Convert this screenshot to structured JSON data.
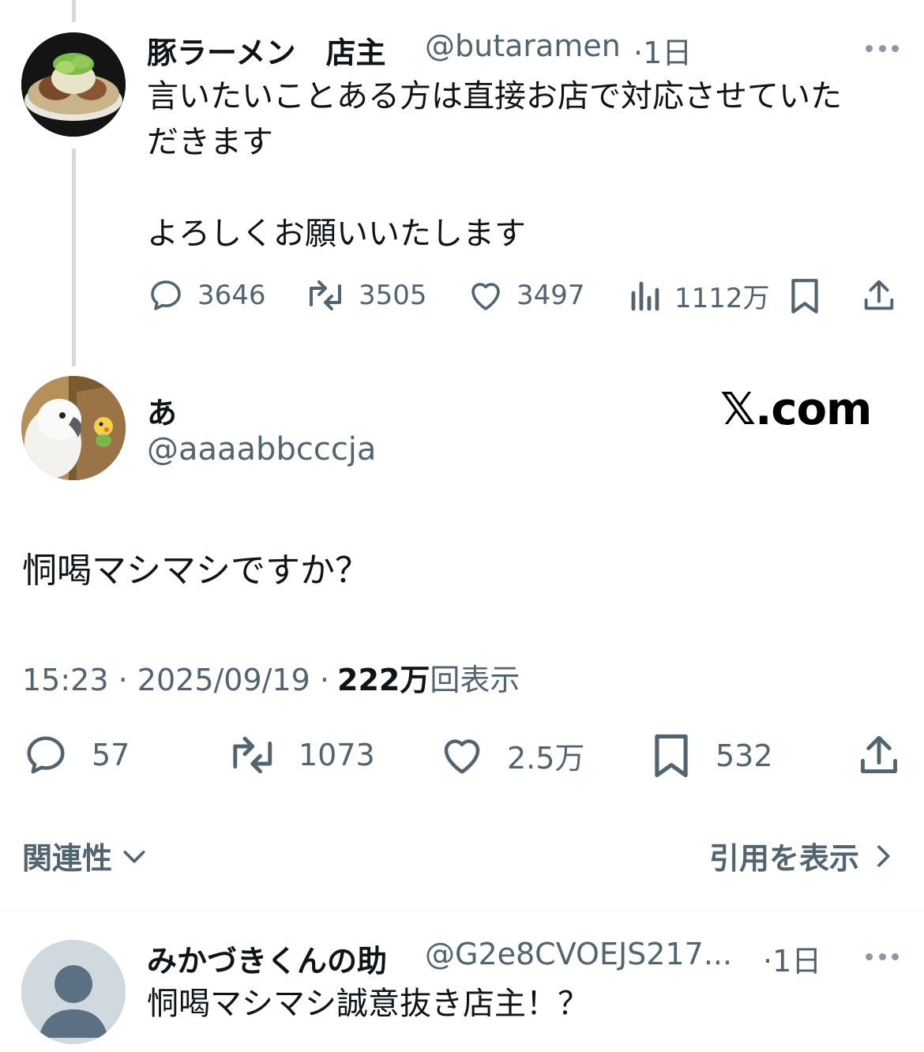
{
  "quoted_tweet": {
    "name": "豚ラーメン　店主",
    "handle": "@butaramen",
    "time": "·1日",
    "text_line1": "言いたいことある方は直接お店で対応させていた",
    "text_line2": "だきます",
    "text_line3": "よろしくお願いいたします",
    "replies": "3646",
    "retweets": "3505",
    "likes": "3497",
    "views": "1112万"
  },
  "main_tweet": {
    "name": "あ",
    "handle": "@aaaabbcccja",
    "watermark": "𝕏.com",
    "text": "恫喝マシマシですか？",
    "time": "15:23",
    "date": "2025/09/19",
    "views_count": "222万",
    "views_label": "回表示",
    "replies": "57",
    "retweets": "1073",
    "likes": "2.5万",
    "bookmarks": "532"
  },
  "sort": {
    "label": "関連性",
    "quotes_link": "引用を表示"
  },
  "reply_tweet": {
    "name": "みかづきくんの助",
    "handle": "@G2e8CVOEJS217...",
    "time": "·1日",
    "text": "恫喝マシマシ誠意抜き店主！？"
  },
  "colors": {
    "text": "#0f1419",
    "muted": "#536471",
    "thread_line": "#cfd9de"
  }
}
